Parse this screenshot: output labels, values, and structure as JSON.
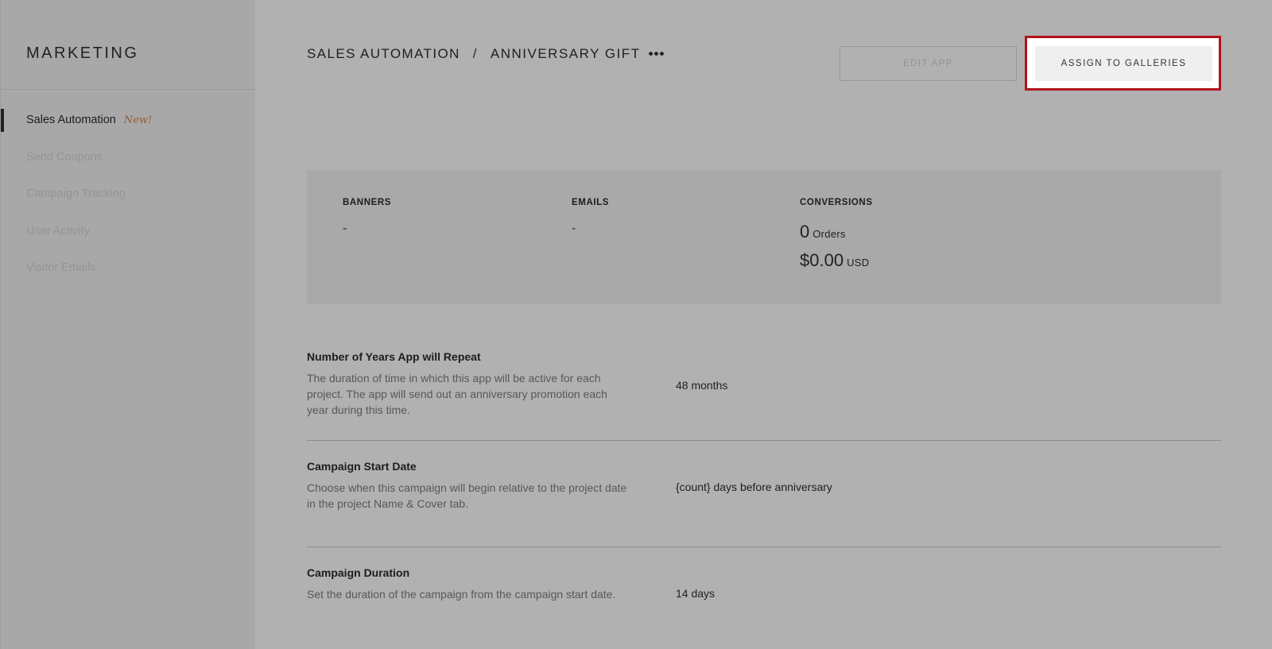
{
  "sidebar": {
    "title": "MARKETING",
    "items": [
      {
        "label": "Sales Automation",
        "badge": "New!"
      },
      {
        "label": "Send Coupons"
      },
      {
        "label": "Campaign Tracking"
      },
      {
        "label": "User Activity"
      },
      {
        "label": "Visitor Emails"
      }
    ]
  },
  "header": {
    "breadcrumb_parent": "SALES AUTOMATION",
    "breadcrumb_separator": "/",
    "breadcrumb_current": "ANNIVERSARY GIFT",
    "more_icon": "•••",
    "edit_label": "EDIT APP",
    "assign_label": "ASSIGN TO GALLERIES"
  },
  "stats": {
    "banners_label": "BANNERS",
    "banners_value": "-",
    "emails_label": "EMAILS",
    "emails_value": "-",
    "conversions_label": "CONVERSIONS",
    "orders_value": "0",
    "orders_unit": "Orders",
    "revenue_value": "$0.00",
    "revenue_unit": "USD"
  },
  "settings": [
    {
      "title": "Number of Years App will Repeat",
      "description": "The duration of time in which this app will be active for each project. The app will send out an anniversary promotion each year during this time.",
      "value": "48 months"
    },
    {
      "title": "Campaign Start Date",
      "description": "Choose when this campaign will begin relative to the project date in the project Name & Cover tab.",
      "value": "{count} days before anniversary"
    },
    {
      "title": "Campaign Duration",
      "description": "Set the duration of the campaign from the campaign start date.",
      "value": "14 days"
    }
  ],
  "colors": {
    "highlight": "#b0131a",
    "badge": "#8f5e3a",
    "overlay_background": "#b1b1b1"
  }
}
